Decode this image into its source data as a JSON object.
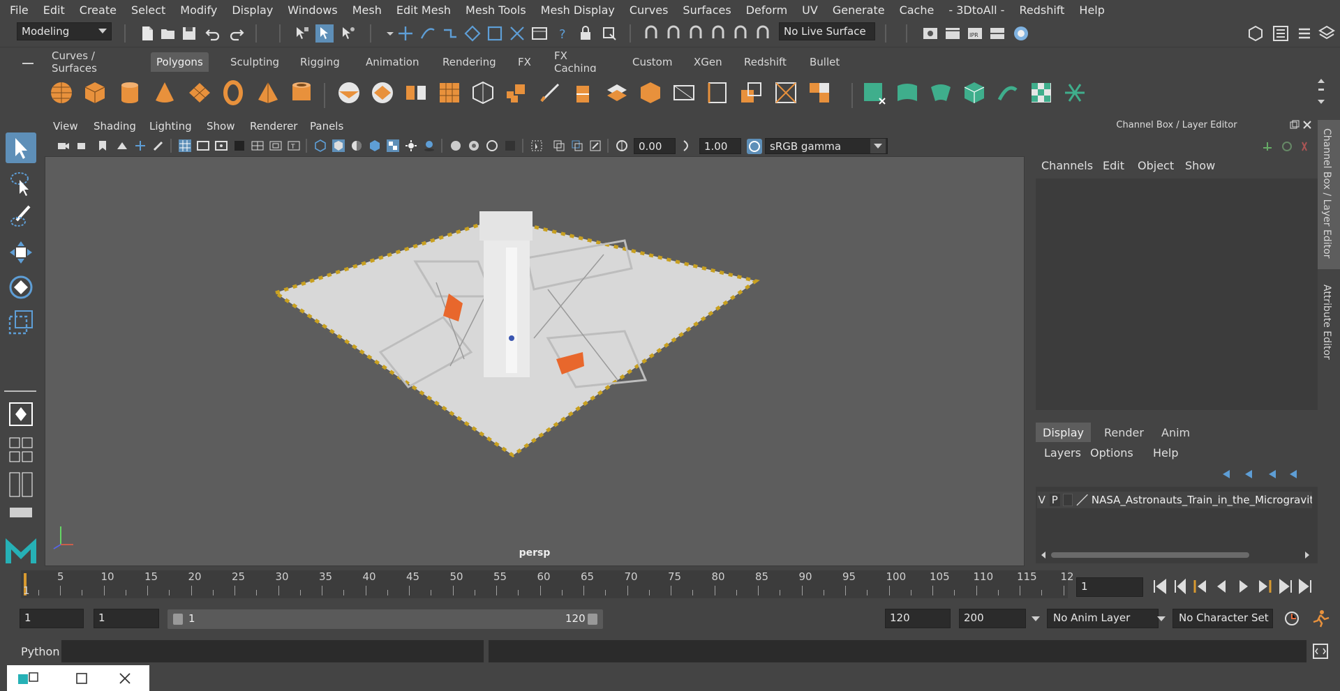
{
  "menubar": [
    "File",
    "Edit",
    "Create",
    "Select",
    "Modify",
    "Display",
    "Windows",
    "Mesh",
    "Edit Mesh",
    "Mesh Tools",
    "Mesh Display",
    "Curves",
    "Surfaces",
    "Deform",
    "UV",
    "Generate",
    "Cache",
    "- 3DtoAll -",
    "Redshift",
    "Help"
  ],
  "status": {
    "mode": "Modeling",
    "live_surface": "No Live Surface"
  },
  "shelf_tabs": [
    "Curves / Surfaces",
    "Polygons",
    "Sculpting",
    "Rigging",
    "Animation",
    "Rendering",
    "FX",
    "FX Caching",
    "Custom",
    "XGen",
    "Redshift",
    "Bullet"
  ],
  "shelf_active": "Polygons",
  "viewport": {
    "menu": [
      "View",
      "Shading",
      "Lighting",
      "Show",
      "Renderer",
      "Panels"
    ],
    "exposure": "0.00",
    "gamma": "1.00",
    "color_space": "sRGB gamma",
    "camera_label": "persp"
  },
  "channel_box": {
    "title": "Channel Box / Layer Editor",
    "menu": [
      "Channels",
      "Edit",
      "Object",
      "Show"
    ]
  },
  "layer_editor": {
    "tabs": [
      "Display",
      "Render",
      "Anim"
    ],
    "menu": [
      "Layers",
      "Options",
      "Help"
    ],
    "layer": {
      "v": "V",
      "p": "P",
      "name": "NASA_Astronauts_Train_in_the_Microgravity"
    }
  },
  "side_tabs": [
    "Channel Box / Layer Editor",
    "Attribute Editor"
  ],
  "timeline": {
    "ticks": [
      "5",
      "10",
      "15",
      "20",
      "25",
      "30",
      "35",
      "40",
      "45",
      "50",
      "55",
      "60",
      "65",
      "70",
      "75",
      "80",
      "85",
      "90",
      "95",
      "100",
      "105",
      "110",
      "115",
      "12"
    ],
    "start_marker": "1",
    "current_frame": "1"
  },
  "range": {
    "start": "1",
    "anim_start": "1",
    "slider_start": "1",
    "slider_end": "120",
    "anim_end": "120",
    "end": "200",
    "anim_layer": "No Anim Layer",
    "character_set": "No Character Set"
  },
  "python": {
    "label": "Python"
  },
  "colors": {
    "accent": "#5e8fb8",
    "shelf_orange": "#e8913c",
    "shelf_green": "#3fae8c",
    "timeline_marker": "#d89a30"
  }
}
